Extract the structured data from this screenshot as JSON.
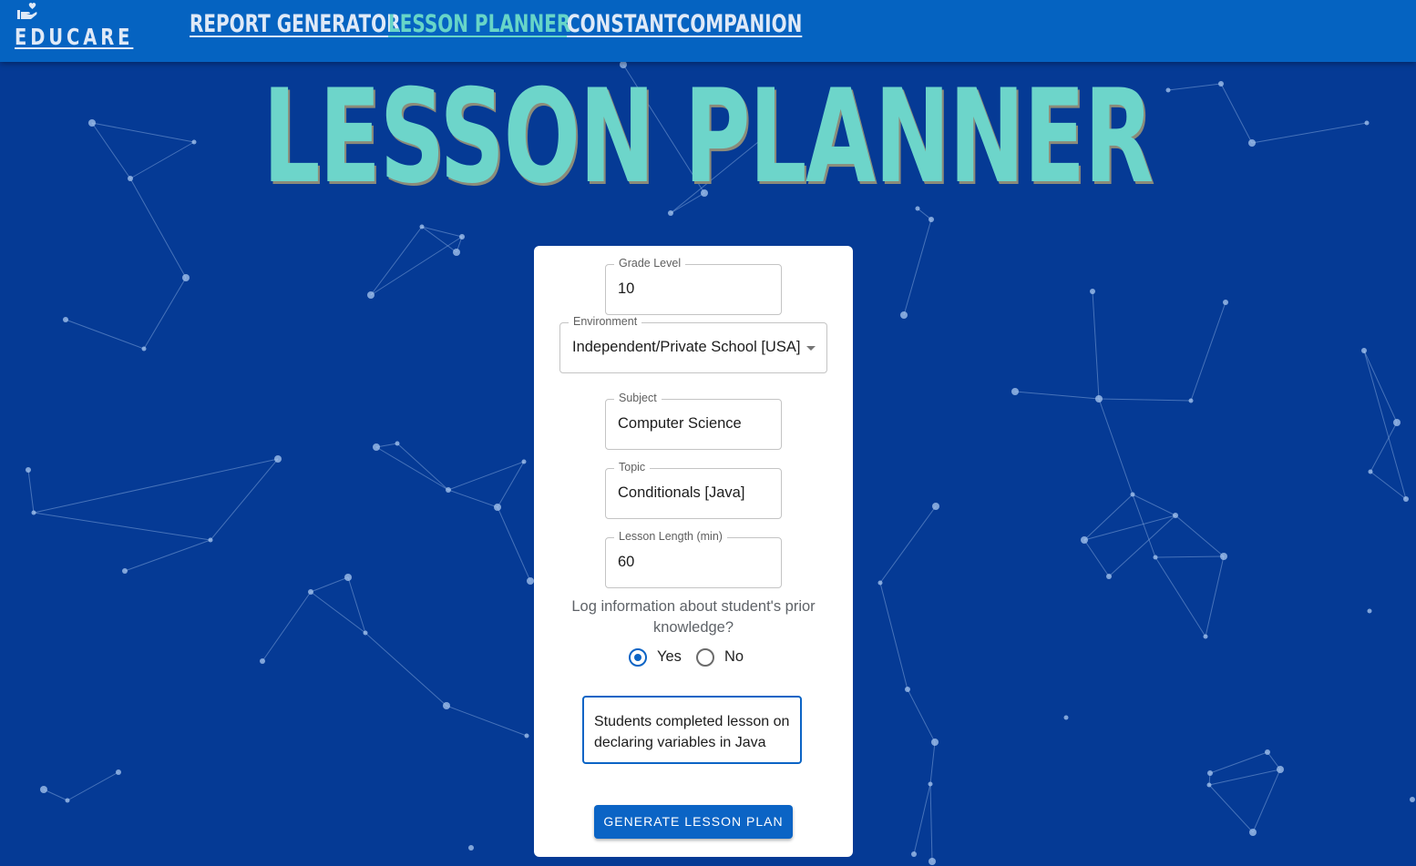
{
  "brand": {
    "name": "EDUCARE",
    "icon": "hand-heart-icon"
  },
  "nav": {
    "items": [
      {
        "label": "REPORT GENERATOR",
        "active": false
      },
      {
        "label": "LESSON PLANNER",
        "active": true
      },
      {
        "label": "CONSTANTCOMPANION",
        "active": false
      }
    ]
  },
  "page": {
    "title": "LESSON PLANNER"
  },
  "form": {
    "grade_level": {
      "label": "Grade Level",
      "value": "10"
    },
    "environment": {
      "label": "Environment",
      "value": "Independent/Private School [USA]",
      "icon": "dropdown-arrow-icon"
    },
    "subject": {
      "label": "Subject",
      "value": "Computer Science"
    },
    "topic": {
      "label": "Topic",
      "value": "Conditionals [Java]"
    },
    "lesson_length": {
      "label": "Lesson Length (min)",
      "value": "60"
    },
    "prior_knowledge_question": "Log information about student's prior knowledge?",
    "radio": {
      "yes_label": "Yes",
      "no_label": "No",
      "selected": "Yes"
    },
    "notes": "Students completed lesson on declaring variables in Java",
    "submit_label": "GENERATE LESSON PLAN"
  },
  "colors": {
    "background": "#053a95",
    "topbar": "#0563c1",
    "title_teal": "#6dd5ca",
    "primary_button": "#0b64c5"
  }
}
